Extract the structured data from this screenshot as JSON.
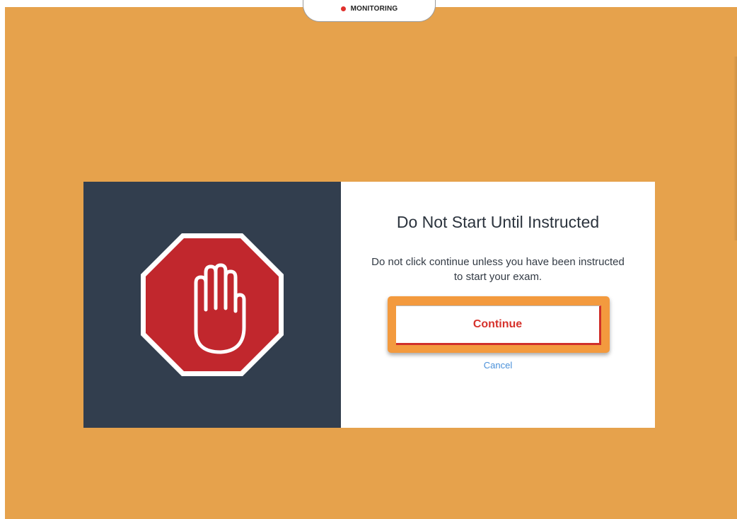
{
  "banner": {
    "label": "MONITORING",
    "dot_color": "#e0302c"
  },
  "background_color": "#e6a24c",
  "modal": {
    "icon": "stop-hand-icon",
    "title": "Do Not Start Until Instructed",
    "message": "Do not click continue unless you have been instructed to start your exam.",
    "continue_label": "Continue",
    "cancel_label": "Cancel"
  },
  "colors": {
    "left_panel": "#323e4e",
    "stop_sign": "#c1272d",
    "continue_text": "#d6322c",
    "cancel_link": "#4a90d9",
    "highlight": "#f39a3e"
  }
}
